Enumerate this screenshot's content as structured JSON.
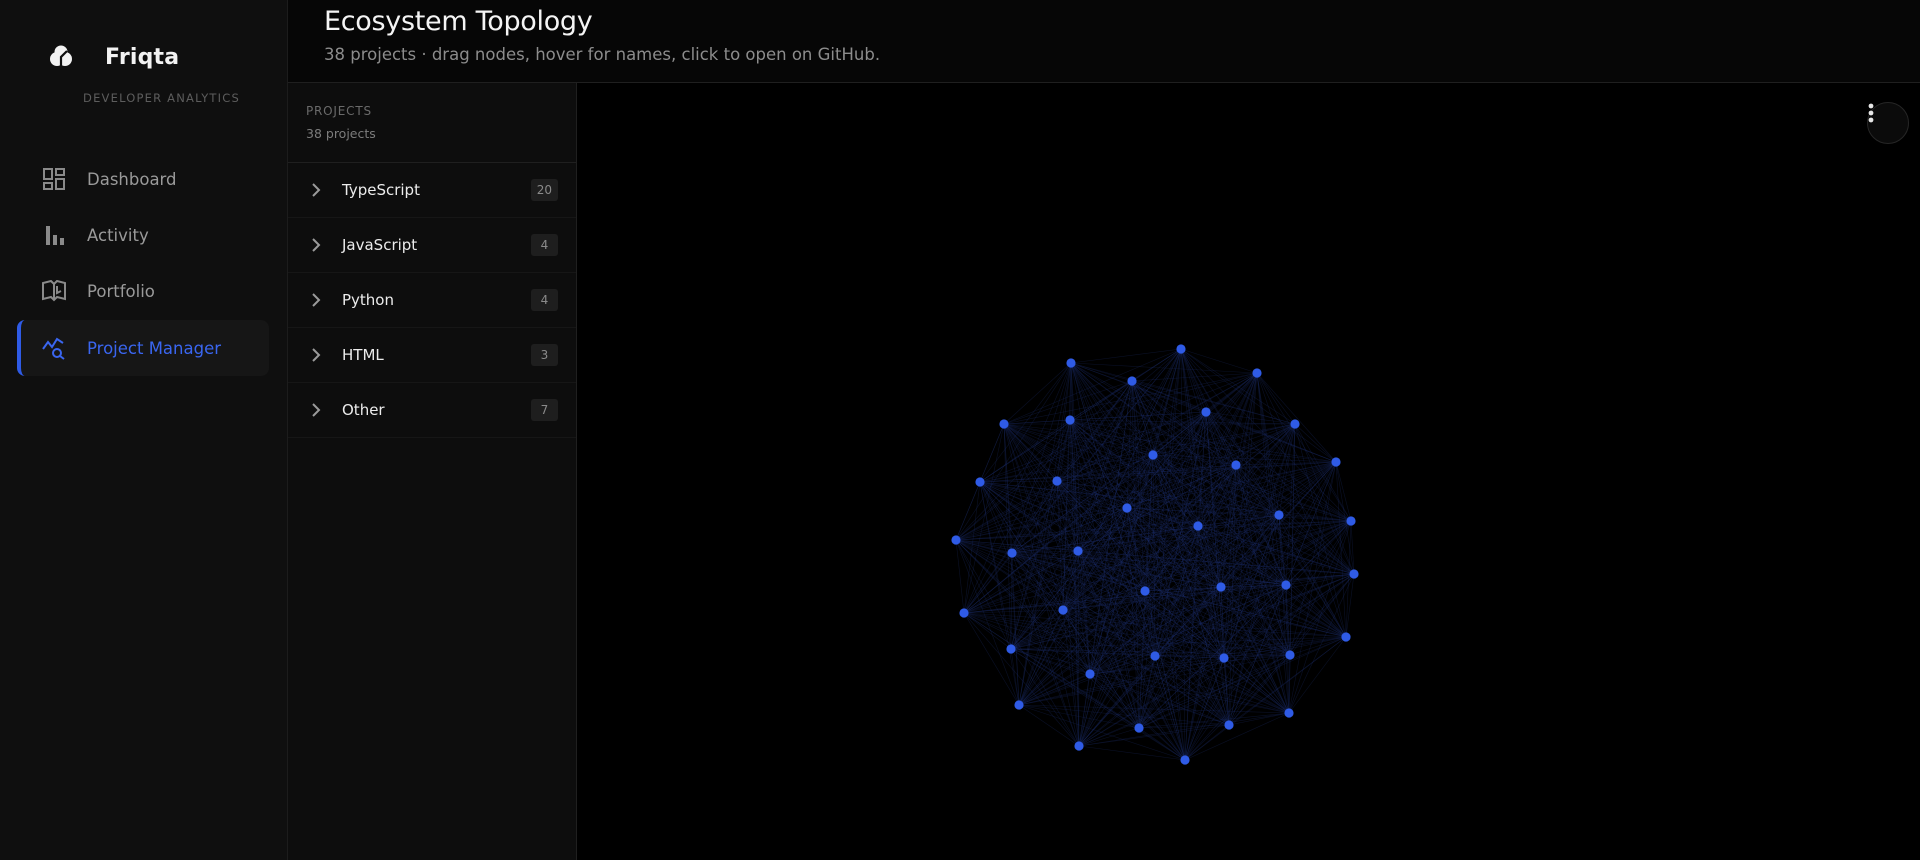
{
  "brand": {
    "name": "Friqta",
    "subtitle": "DEVELOPER ANALYTICS"
  },
  "nav": {
    "items": [
      {
        "label": "Dashboard",
        "icon": "dashboard-icon",
        "active": false
      },
      {
        "label": "Activity",
        "icon": "bar-chart-icon",
        "active": false
      },
      {
        "label": "Portfolio",
        "icon": "book-open-icon",
        "active": false
      },
      {
        "label": "Project Manager",
        "icon": "trend-search-icon",
        "active": true
      }
    ]
  },
  "header": {
    "title": "Ecosystem Topology",
    "subtitle": "38 projects · drag nodes, hover for names, click to open on GitHub."
  },
  "projects_panel": {
    "kicker": "PROJECTS",
    "count_label": "38 projects",
    "groups": [
      {
        "label": "TypeScript",
        "count": "20"
      },
      {
        "label": "JavaScript",
        "count": "4"
      },
      {
        "label": "Python",
        "count": "4"
      },
      {
        "label": "HTML",
        "count": "3"
      },
      {
        "label": "Other",
        "count": "7"
      }
    ]
  },
  "graph": {
    "node_color": "#2f5be6",
    "edge_color": "#1c2f6e",
    "menu_icon": "more-vertical-icon"
  },
  "colors": {
    "accent": "#2f5be6",
    "background": "#000000",
    "sidebar": "#0f0f0f"
  }
}
